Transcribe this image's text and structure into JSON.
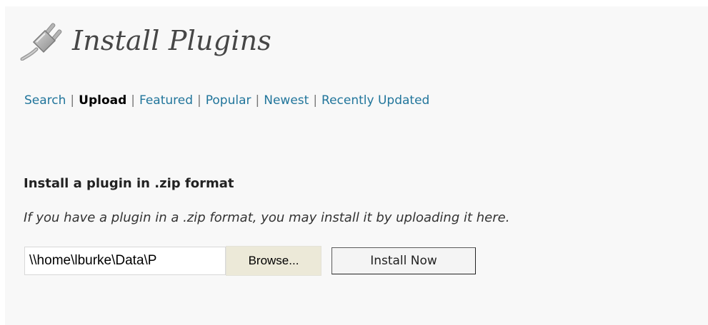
{
  "header": {
    "icon": "plugin-plug-icon",
    "title": "Install Plugins"
  },
  "subnav": {
    "items": [
      {
        "label": "Search",
        "current": false
      },
      {
        "label": "Upload",
        "current": true
      },
      {
        "label": "Featured",
        "current": false
      },
      {
        "label": "Popular",
        "current": false
      },
      {
        "label": "Newest",
        "current": false
      },
      {
        "label": "Recently Updated",
        "current": false
      }
    ],
    "separator": "|"
  },
  "upload": {
    "heading": "Install a plugin in .zip format",
    "description": "If you have a plugin in a .zip format, you may install it by uploading it here.",
    "file_value": "\\\\home\\lburke\\Data\\P",
    "browse_label": "Browse...",
    "install_label": "Install Now"
  },
  "colors": {
    "link": "#21759b",
    "panel_background": "#f8f8f8",
    "title": "#464646"
  }
}
